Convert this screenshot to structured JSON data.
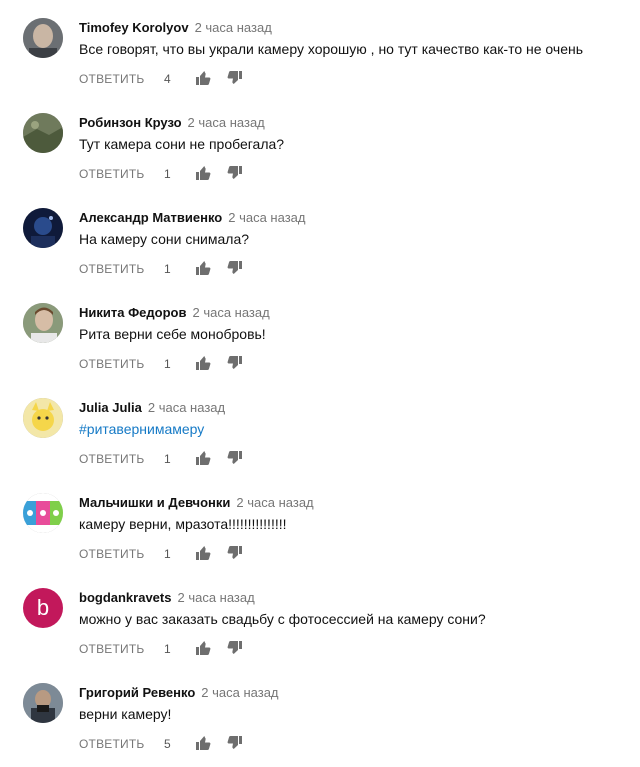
{
  "colors": {
    "author": "#111111",
    "timestamp": "#767676",
    "action": "#767676",
    "hashtag": "#167ac6",
    "thumb_icon": "#6e6e6e"
  },
  "comments": [
    {
      "author": "Timofey Korolyov",
      "time": "2 часа назад",
      "text": "Все говорят, что вы украли камеру хорошую , но тут качество как-то не очень",
      "reply_label": "ОТВЕТИТЬ",
      "likes": "4",
      "avatar_icon": "photo-avatar-icon"
    },
    {
      "author": "Робинзон Крузо",
      "time": "2 часа назад",
      "text": "Тут камера сони не пробегала?",
      "reply_label": "ОТВЕТИТЬ",
      "likes": "1",
      "avatar_icon": "photo-avatar-icon"
    },
    {
      "author": "Александр Матвиенко",
      "time": "2 часа назад",
      "text": "На камеру сони снимала?",
      "reply_label": "ОТВЕТИТЬ",
      "likes": "1",
      "avatar_icon": "photo-avatar-icon"
    },
    {
      "author": "Никита Федоров",
      "time": "2 часа назад",
      "text": "Рита верни себе монобровь!",
      "reply_label": "ОТВЕТИТЬ",
      "likes": "1",
      "avatar_icon": "photo-avatar-icon"
    },
    {
      "author": "Julia Julia",
      "time": "2 часа назад",
      "text": "#ритавернимамеру",
      "reply_label": "ОТВЕТИТЬ",
      "likes": "1",
      "avatar_icon": "photo-avatar-icon"
    },
    {
      "author": "Мальчишки и Девчонки",
      "time": "2 часа назад",
      "text": "камеру верни, мразота!!!!!!!!!!!!!!!",
      "reply_label": "ОТВЕТИТЬ",
      "likes": "1",
      "avatar_icon": "photo-avatar-icon"
    },
    {
      "author": "bogdankravets",
      "time": "2 часа назад",
      "text": "можно у вас заказать свадьбу с фотосессией на камеру сони?",
      "reply_label": "ОТВЕТИТЬ",
      "likes": "1",
      "avatar_letter": "b",
      "avatar_icon": "letter-avatar-icon"
    },
    {
      "author": "Григорий Ревенко",
      "time": "2 часа назад",
      "text": "верни камеру!",
      "reply_label": "ОТВЕТИТЬ",
      "likes": "5",
      "avatar_icon": "photo-avatar-icon"
    }
  ]
}
